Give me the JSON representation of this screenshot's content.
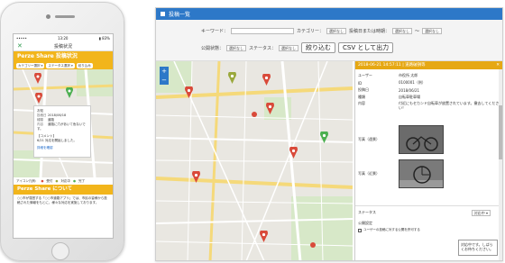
{
  "mobile": {
    "status_left": "•••••",
    "status_time": "13:20",
    "status_right": "▮ 83%",
    "close_icon": "close-icon",
    "nav_title": "投稿状況",
    "section_title": "Perze Share 投稿状況",
    "filters": [
      "カテゴリー選択 ▾",
      "ステータス選択 ▾",
      "絞り込み"
    ],
    "popup": {
      "title": "お知",
      "rows": [
        {
          "label": "投稿日",
          "value": "2018/06/18"
        },
        {
          "label": "種類",
          "value": "道路"
        },
        {
          "label": "内容",
          "value": "道路に穴があいて危ないです。"
        }
      ],
      "comment_title": "【コメント】",
      "comment_text": "6/21 対応を開始しました。",
      "link": "詳細を確認"
    },
    "legend": [
      "アイコン凡例：",
      "受付",
      "対応中",
      "完了"
    ],
    "about_title": "Perze Share について",
    "about_text": "○○市が運営する「○○市道路アプリ」では、市民の皆様から投稿された情報をもとに、様々な対応を実施しております。"
  },
  "desktop": {
    "header_title": "投稿一覧",
    "keyword_label": "キーワード：",
    "category_label": "カテゴリー：",
    "category_value": "選択なし",
    "date_label": "投稿日または時期：",
    "date_from": "選択なし",
    "date_sep": "～",
    "date_to": "選択なし",
    "public_label": "公開状態：",
    "public_value": "選択なし",
    "status_label": "ステータス：",
    "status_value": "選択なし",
    "filter_button": "絞り込む",
    "csv_button": "CSV として出力",
    "zoom_in": "+",
    "zoom_out": "−",
    "panel": {
      "header": "2018-06-21 14:57:11 | 道路破損等",
      "close": "✕",
      "rows": [
        {
          "k": "ユーザー",
          "v": "市役所 太郎"
        },
        {
          "k": "ID",
          "v": "0100001（例）"
        },
        {
          "k": "投稿日",
          "v": "2018/06/21"
        },
        {
          "k": "種類",
          "v": "自転車駐車場"
        },
        {
          "k": "内容",
          "v": "付近にもセカンド自転車が放置されています。撤去してください！"
        }
      ],
      "photo1_label": "写真（遠景）",
      "photo2_label": "写真（近景）",
      "status_label": "ステータス",
      "status_value": "対応中 ▾",
      "public_label": "公開設定",
      "public_option": "ユーザーの投稿に対する公開を許可する",
      "memo_text": "対応中です。しばらくお待ちください。"
    }
  },
  "colors": {
    "accent_orange": "#f2b51b",
    "header_blue": "#2d78c8",
    "pin_red": "#d94a3a",
    "pin_green": "#4caf50",
    "pin_olive": "#9aa83c"
  }
}
